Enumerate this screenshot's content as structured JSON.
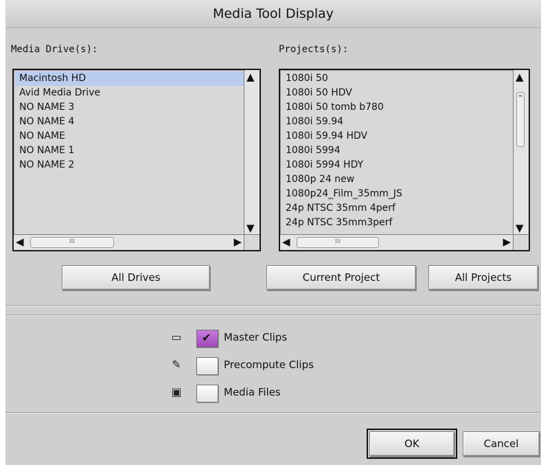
{
  "dialog": {
    "title": "Media Tool Display"
  },
  "media_drives": {
    "label": "Media Drive(s):",
    "items": [
      "Macintosh HD",
      "Avid Media Drive",
      "NO NAME 3",
      "NO NAME 4",
      "NO NAME",
      "NO NAME 1",
      "NO NAME 2"
    ],
    "selected": "Macintosh HD"
  },
  "projects": {
    "label": "Projects(s):",
    "items": [
      "1080i 50",
      "1080i 50 HDV",
      "1080i 50 tomb b780",
      "1080i 59.94",
      "1080i 59.94 HDV",
      "1080i 5994",
      "1080i 5994 HDY",
      "1080p 24 new",
      "1080p24_Film_35mm_JS",
      "24p NTSC 35mm 4perf",
      "24p NTSC 35mm3perf"
    ]
  },
  "buttons": {
    "all_drives": "All Drives",
    "current_project": "Current Project",
    "all_projects": "All Projects",
    "ok": "OK",
    "cancel": "Cancel"
  },
  "options": {
    "master_clips": {
      "label": "Master Clips",
      "checked": true,
      "icon": "film-strip-icon"
    },
    "precompute_clips": {
      "label": "Precompute Clips",
      "checked": false,
      "icon": "precompute-icon"
    },
    "media_files": {
      "label": "Media Files",
      "checked": false,
      "icon": "media-file-icon"
    }
  },
  "colors": {
    "selection": "#b9ccee",
    "checkbox_checked": "#b060cc",
    "dialog_bg": "#cfcfcf"
  }
}
